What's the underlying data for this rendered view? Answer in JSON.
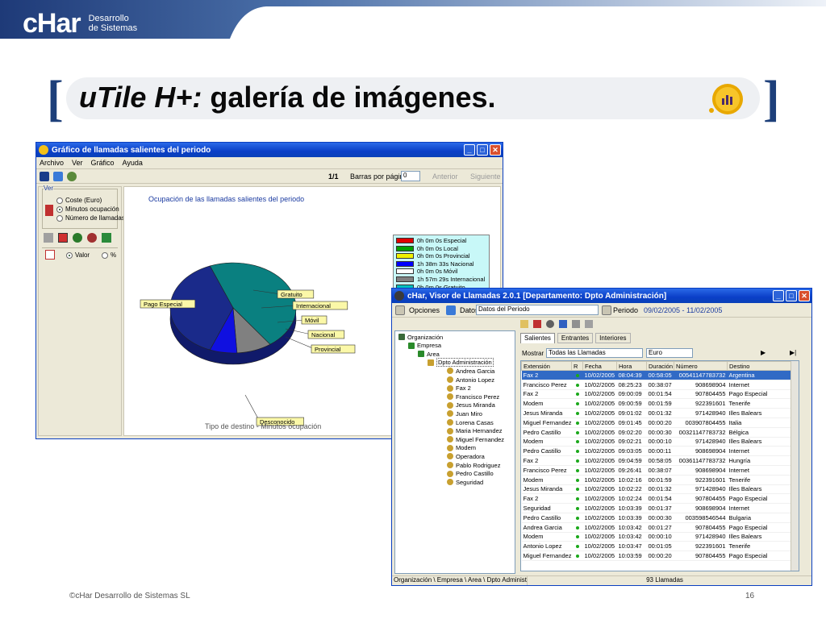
{
  "brand": {
    "logo": "cHar",
    "line1": "Desarrollo",
    "line2": "de Sistemas"
  },
  "title": {
    "italic": "uTile H+:",
    "rest": " galería de imágenes."
  },
  "chart_window": {
    "title": "Gráfico de llamadas salientes del periodo",
    "menu": [
      "Archivo",
      "Ver",
      "Gráfico",
      "Ayuda"
    ],
    "page": "1/1",
    "bars_label": "Barras por página",
    "bars_value": "0",
    "prev": "Anterior",
    "next": "Siguiente",
    "group_label": "Ver",
    "radios": [
      "Coste (Euro)",
      "Minutos ocupación",
      "Número de llamadas"
    ],
    "radio_selected": 1,
    "value_radio": "Valor",
    "pct_radio": "%",
    "plot_title": "Ocupación de las llamadas salientes del periodo",
    "plot_footer": "Tipo de destino - Minutos ocupación",
    "pie_labels": [
      "Gratuito",
      "Internacional",
      "Pago Especial",
      "Móvil",
      "Nacional",
      "Provincial",
      "Desconocido"
    ],
    "legend": [
      {
        "text": "0h 0m 0s Especial",
        "color": "#e00000"
      },
      {
        "text": "0h 0m 0s Local",
        "color": "#00a000"
      },
      {
        "text": "0h 0m 0s Provincial",
        "color": "#f0f000"
      },
      {
        "text": "1h 38m 33s Nacional",
        "color": "#0000ff"
      },
      {
        "text": "0h 0m 0s Móvil",
        "color": "#ffffff"
      },
      {
        "text": "1h 57m 29s Internacional",
        "color": "#808080"
      },
      {
        "text": "0h 0m 0s Gratuito",
        "color": "#00c0c0"
      }
    ]
  },
  "chart_data": {
    "type": "pie",
    "title": "Ocupación de las llamadas salientes del periodo",
    "xlabel": "Tipo de destino - Minutos ocupación",
    "slices": [
      {
        "label": "Pago Especial",
        "value": 46,
        "color": "#0a8080"
      },
      {
        "label": "Internacional",
        "value": 9,
        "color": "#808080"
      },
      {
        "label": "Nacional",
        "value": 7,
        "color": "#1010e0"
      },
      {
        "label": "Desconocido",
        "value": 38,
        "color": "#1a2a8a"
      }
    ]
  },
  "viewer_window": {
    "title": "cHar, Visor de Llamadas 2.0.1 [Departamento: Dpto Administración]",
    "options": "Opciones",
    "data_btn": "Datos",
    "data_select": "Datos del Periodo",
    "period_label": "Periodo",
    "period_value": "09/02/2005 - 11/02/2005",
    "tabs": [
      "Salientes",
      "Entrantes",
      "Interiores"
    ],
    "show_label": "Mostrar",
    "show_value": "Todas las Llamadas",
    "currency": "Euro",
    "tree": [
      "Organización",
      "Empresa",
      "Area",
      "Dpto Administración",
      "Andrea Garcia",
      "Antonio Lopez",
      "Fax 2",
      "Francisco Perez",
      "Jesus Miranda",
      "Juan Miro",
      "Lorena Casas",
      "Maria Hernandez",
      "Miguel Fernandez",
      "Modem",
      "Operadora",
      "Pablo Rodriguez",
      "Pedro Castillo",
      "Seguridad"
    ],
    "columns": [
      "Extensión",
      "R",
      "Fecha",
      "Hora",
      "Duración",
      "Número",
      "Destino"
    ],
    "rows": [
      [
        "Fax 2",
        "10/02/2005",
        "08:04:39",
        "00:58:05",
        "00541147783732",
        "Argentina"
      ],
      [
        "Francisco Perez",
        "10/02/2005",
        "08:25:23",
        "00:38:07",
        "908698904",
        "Internet"
      ],
      [
        "Fax 2",
        "10/02/2005",
        "09:00:09",
        "00:01:54",
        "907804455",
        "Pago Especial"
      ],
      [
        "Modem",
        "10/02/2005",
        "09:00:59",
        "00:01:59",
        "922391601",
        "Tenerife"
      ],
      [
        "Jesus Miranda",
        "10/02/2005",
        "09:01:02",
        "00:01:32",
        "971428940",
        "Illes Balears"
      ],
      [
        "Miguel Fernandez",
        "10/02/2005",
        "09:01:45",
        "00:00:20",
        "003907804455",
        "Italia"
      ],
      [
        "Pedro Castillo",
        "10/02/2005",
        "09:02:20",
        "00:00:30",
        "00321147783732",
        "Bélgica"
      ],
      [
        "Modem",
        "10/02/2005",
        "09:02:21",
        "00:00:10",
        "971428940",
        "Illes Balears"
      ],
      [
        "Pedro Castillo",
        "10/02/2005",
        "09:03:05",
        "00:00:11",
        "908698904",
        "Internet"
      ],
      [
        "Fax 2",
        "10/02/2005",
        "09:04:59",
        "00:58:05",
        "00361147783732",
        "Hungría"
      ],
      [
        "Francisco Perez",
        "10/02/2005",
        "09:26:41",
        "00:38:07",
        "908698904",
        "Internet"
      ],
      [
        "Modem",
        "10/02/2005",
        "10:02:16",
        "00:01:59",
        "922391601",
        "Tenerife"
      ],
      [
        "Jesus Miranda",
        "10/02/2005",
        "10:02:22",
        "00:01:32",
        "971428940",
        "Illes Balears"
      ],
      [
        "Fax 2",
        "10/02/2005",
        "10:02:24",
        "00:01:54",
        "907804455",
        "Pago Especial"
      ],
      [
        "Seguridad",
        "10/02/2005",
        "10:03:39",
        "00:01:37",
        "908698904",
        "Internet"
      ],
      [
        "Pedro Castillo",
        "10/02/2005",
        "10:03:39",
        "00:00:30",
        "003598546544",
        "Bulgaria"
      ],
      [
        "Andrea Garcia",
        "10/02/2005",
        "10:03:42",
        "00:01:27",
        "907804455",
        "Pago Especial"
      ],
      [
        "Modem",
        "10/02/2005",
        "10:03:42",
        "00:00:10",
        "971428940",
        "Illes Balears"
      ],
      [
        "Antonio Lopez",
        "10/02/2005",
        "10:03:47",
        "00:01:05",
        "922391601",
        "Tenerife"
      ],
      [
        "Miguel Fernandez",
        "10/02/2005",
        "10:03:59",
        "00:00:20",
        "907804455",
        "Pago Especial"
      ]
    ],
    "status_path": "Organización \\ Empresa \\ Area \\ Dpto Administración",
    "status_count": "93 Llamadas"
  },
  "footer": {
    "left": "©cHar Desarrollo de Sistemas SL",
    "page": "16"
  }
}
